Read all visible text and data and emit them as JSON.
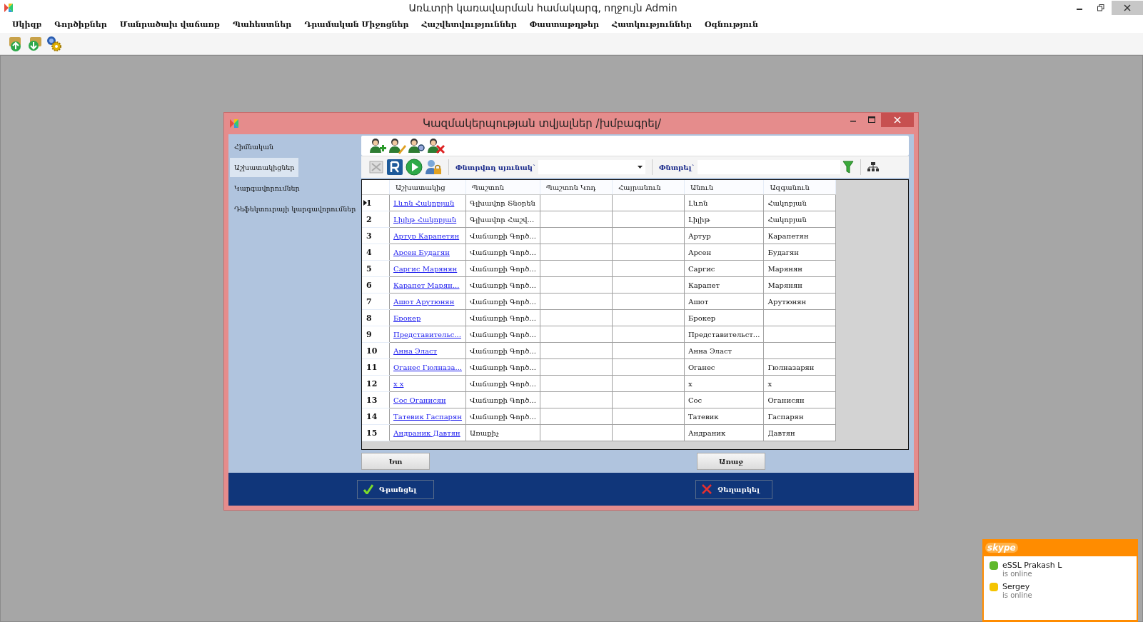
{
  "window": {
    "title": "Առևտրի կառավարման համակարգ, ողջույն Admin"
  },
  "menu": [
    "Սկիզբ",
    "Գործիքներ",
    "Մանրածախ վաճառք",
    "Պահեստներ",
    "Դրամական Միջոցներ",
    "Հաշվետվություններ",
    "Փաստաթղթեր",
    "Հատկություններ",
    "Օգնություն"
  ],
  "dialog": {
    "title": "Կազմակերպության տվյալներ /խմբագրել/",
    "sidebar": [
      {
        "label": "Հիմնական",
        "selected": false
      },
      {
        "label": "Աշխատակիցներ",
        "selected": true
      },
      {
        "label": "Կարգավորումներ",
        "selected": false
      },
      {
        "label": "Դեֆեկտուրայի կարգավորումներ",
        "selected": false
      }
    ],
    "filter": {
      "column_label": "Փնտրվող սյունակ`",
      "search_label": "Փնտրել`"
    },
    "table": {
      "columns": [
        "Աշխատակից",
        "Պաշտոն",
        "Պաշտոն Կոդ",
        "Հայրանուն",
        "Անուն",
        "Ազգանուն"
      ],
      "rows": [
        {
          "number": "1",
          "selected": true,
          "employee": "Լևոն Հակոբյան",
          "position": "Գլխավոր Տնօրեն",
          "first_name": "Լևոն",
          "last_name": "Հակոբյան"
        },
        {
          "number": "2",
          "selected": false,
          "employee": "Լիլիթ Հակոբյան",
          "position": "Գլխավոր Հաշվ...",
          "first_name": "Լիլիթ",
          "last_name": "Հակոբյան"
        },
        {
          "number": "3",
          "selected": false,
          "employee": "Артур Карапетян",
          "position": "Վաճառքի Գործ...",
          "first_name": "Артур",
          "last_name": "Карапетян"
        },
        {
          "number": "4",
          "selected": false,
          "employee": "Арсен Будагян",
          "position": "Վաճառքի Գործ...",
          "first_name": "Арсен",
          "last_name": "Будагян"
        },
        {
          "number": "5",
          "selected": false,
          "employee": "Саргис Марянян",
          "position": "Վաճառքի Գործ...",
          "first_name": "Саргис",
          "last_name": "Марянян"
        },
        {
          "number": "6",
          "selected": false,
          "employee": "Карапет Марян...",
          "position": "Վաճառքի Գործ...",
          "first_name": "Карапет",
          "last_name": "Марянян"
        },
        {
          "number": "7",
          "selected": false,
          "employee": "Ашот Арутюнян",
          "position": "Վաճառքի Գործ...",
          "first_name": "Ашот",
          "last_name": "Арутюнян"
        },
        {
          "number": "8",
          "selected": false,
          "employee": "Брокер",
          "position": "Վաճառքի Գործ...",
          "first_name": "Брокер"
        },
        {
          "number": "9",
          "selected": false,
          "employee": "Представительс...",
          "position": "Վաճառքի Գործ...",
          "first_name": "Представительст..."
        },
        {
          "number": "10",
          "selected": false,
          "employee": "Анна Эласт",
          "position": "Վաճառքի Գործ...",
          "first_name": "Анна Эласт"
        },
        {
          "number": "11",
          "selected": false,
          "employee": "Оганес Гюлназа...",
          "position": "Վաճառքի Գործ...",
          "first_name": "Оганес",
          "last_name": "Гюлназарян"
        },
        {
          "number": "12",
          "selected": false,
          "employee": "x x",
          "position": "Վաճառքի Գործ...",
          "first_name": "x",
          "last_name": "x"
        },
        {
          "number": "13",
          "selected": false,
          "employee": "Сос Оганисян",
          "position": "Վաճառքի Գործ...",
          "first_name": "Сос",
          "last_name": "Оганисян"
        },
        {
          "number": "14",
          "selected": false,
          "employee": "Татевик Гаспарян",
          "position": "Վաճառքի Գործ...",
          "first_name": "Татевик",
          "last_name": "Гаспарян"
        },
        {
          "number": "15",
          "selected": false,
          "employee": "Андраник Давтян",
          "position": "Առաքիչ",
          "first_name": "Андраник",
          "last_name": "Давтян"
        }
      ]
    },
    "nav_buttons": [
      "Ետ",
      "Առաջ"
    ],
    "save_button": "Գրանցել",
    "cancel_button": "Չեղարկել"
  },
  "skype": {
    "logo": "skype",
    "contacts": [
      {
        "name": "eSSL Prakash L",
        "status": "is online",
        "color": "#5fb82a"
      },
      {
        "name": "Sergey",
        "status": "is online",
        "color": "#f5c400"
      }
    ]
  }
}
